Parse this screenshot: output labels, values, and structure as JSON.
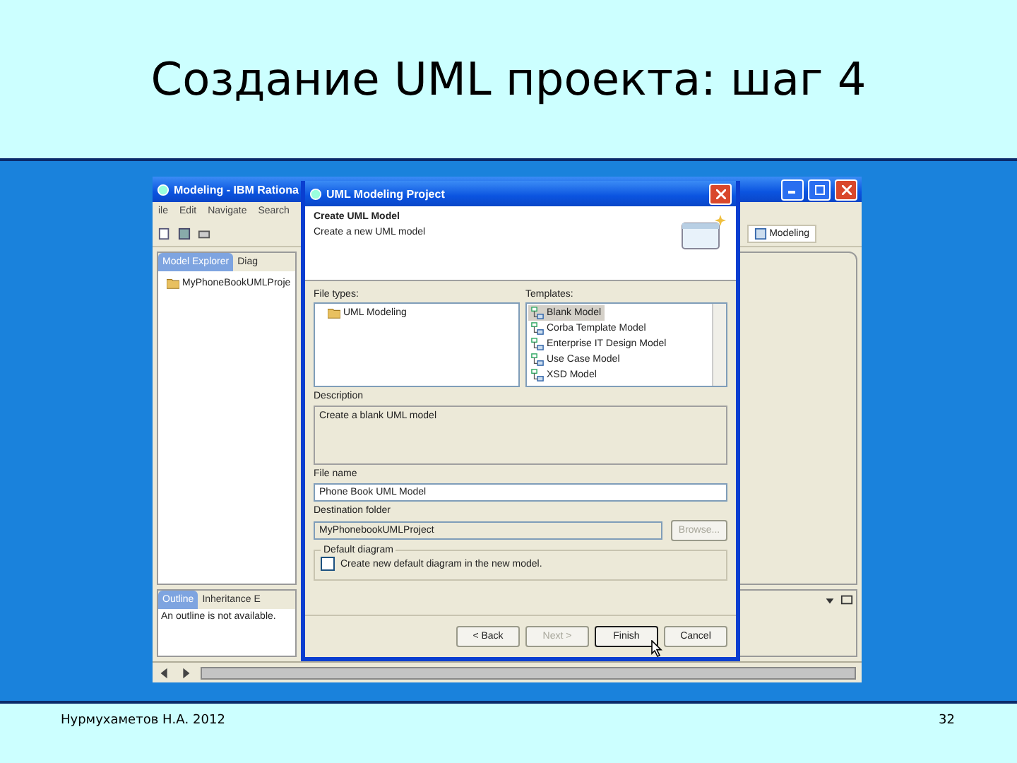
{
  "slide": {
    "title": "Создание UML проекта: шаг 4",
    "author": "Нурмухаметов Н.А. 2012",
    "page_number": "32"
  },
  "ide": {
    "title": "Modeling - IBM Rationa",
    "menu": [
      "ile",
      "Edit",
      "Navigate",
      "Search"
    ],
    "perspective": "Modeling",
    "explorer_tab": "Model Explorer",
    "editor_tab": "Diag",
    "tree_item": "MyPhoneBookUMLProje",
    "outline_tabs": [
      {
        "label": "Outline",
        "selected": true
      },
      {
        "label": "Inheritance E",
        "selected": false
      }
    ],
    "outline_message": "An outline is not available."
  },
  "dialog": {
    "title": "UML Modeling Project",
    "heading": "Create UML Model",
    "subtitle": "Create a new UML model",
    "file_types_label": "File types:",
    "file_types": [
      "UML Modeling"
    ],
    "templates_label": "Templates:",
    "templates": [
      {
        "label": "Blank Model",
        "selected": true
      },
      {
        "label": "Corba Template Model",
        "selected": false
      },
      {
        "label": "Enterprise IT Design Model",
        "selected": false
      },
      {
        "label": "Use Case Model",
        "selected": false
      },
      {
        "label": "XSD Model",
        "selected": false
      }
    ],
    "description_label": "Description",
    "description": "Create a blank UML model",
    "file_name_label": "File name",
    "file_name": "Phone Book UML Model",
    "destination_label": "Destination folder",
    "destination": "MyPhonebookUMLProject",
    "browse": {
      "label": "Browse...",
      "disabled": true
    },
    "group_label": "Default diagram",
    "checkbox": {
      "label": "Create new default diagram in the new model.",
      "checked": false
    },
    "buttons": [
      {
        "label": "< Back",
        "disabled": false,
        "default": false
      },
      {
        "label": "Next >",
        "disabled": true,
        "default": false
      },
      {
        "label": "Finish",
        "disabled": false,
        "default": true
      },
      {
        "label": "Cancel",
        "disabled": false,
        "default": false
      }
    ]
  }
}
